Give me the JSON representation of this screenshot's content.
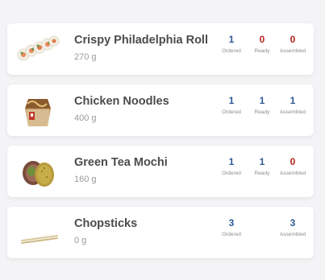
{
  "colors": {
    "ordered": "#2e5a96",
    "alert": "#b3261e",
    "card_bg": "#ffffff",
    "page_bg": "#f4f4f6"
  },
  "items": [
    {
      "name": "Crispy Philadelphia Roll",
      "weight": "270 g",
      "image_icon": "sushi-roll-image",
      "ordered": {
        "value": "1",
        "label": "Ordered"
      },
      "ready": {
        "value": "0",
        "label": "Ready"
      },
      "assembled": {
        "value": "0",
        "label": "Assembled"
      }
    },
    {
      "name": "Chicken Noodles",
      "weight": "400 g",
      "image_icon": "noodle-box-image",
      "ordered": {
        "value": "1",
        "label": "Ordered"
      },
      "ready": {
        "value": "1",
        "label": "Ready"
      },
      "assembled": {
        "value": "1",
        "label": "Assembled"
      }
    },
    {
      "name": "Green Tea Mochi",
      "weight": "160 g",
      "image_icon": "mochi-image",
      "ordered": {
        "value": "1",
        "label": "Ordered"
      },
      "ready": {
        "value": "1",
        "label": "Ready"
      },
      "assembled": {
        "value": "0",
        "label": "Assembled"
      }
    },
    {
      "name": "Chopsticks",
      "weight": "0 g",
      "image_icon": "chopsticks-image",
      "ordered": {
        "value": "3",
        "label": "Ordered"
      },
      "assembled": {
        "value": "3",
        "label": "Assembled"
      }
    }
  ]
}
